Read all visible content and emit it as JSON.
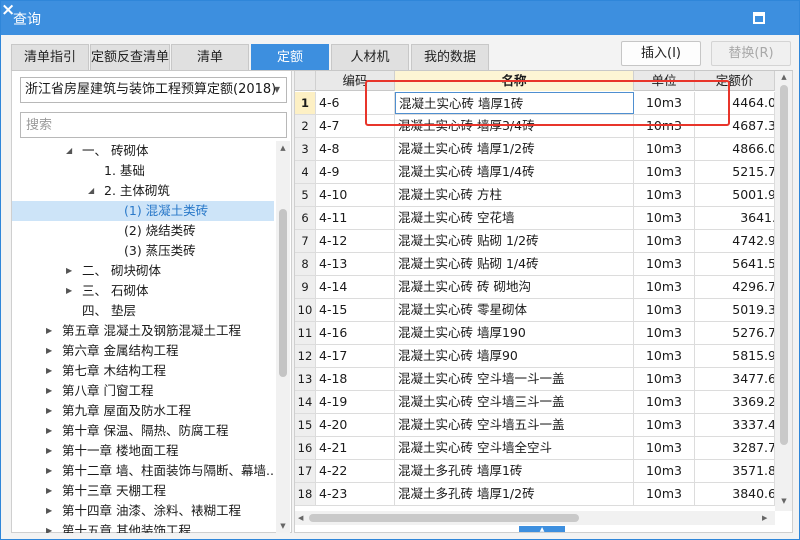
{
  "window": {
    "title": "查询"
  },
  "tabs": [
    {
      "label": "清单指引",
      "active": false
    },
    {
      "label": "定额反查清单",
      "active": false
    },
    {
      "label": "清单",
      "active": false
    },
    {
      "label": "定额",
      "active": true
    },
    {
      "label": "人材机",
      "active": false
    },
    {
      "label": "我的数据",
      "active": false
    }
  ],
  "buttons": {
    "insert": "插入(I)",
    "replace": "替换(R)"
  },
  "left": {
    "combo_value": "浙江省房屋建筑与装饰工程预算定额(2018)",
    "search_placeholder": "搜索",
    "tree": [
      {
        "label": "一、 砖砌体",
        "twisty": "expanded",
        "selected": false
      },
      {
        "label": "1. 基础",
        "twisty": "none",
        "selected": false
      },
      {
        "label": "2. 主体砌筑",
        "twisty": "expanded",
        "selected": false
      },
      {
        "label": "(1) 混凝土类砖",
        "twisty": "none",
        "selected": true
      },
      {
        "label": "(2) 烧结类砖",
        "twisty": "none",
        "selected": false
      },
      {
        "label": "(3) 蒸压类砖",
        "twisty": "none",
        "selected": false
      },
      {
        "label": "二、 砌块砌体",
        "twisty": "collapsed",
        "selected": false
      },
      {
        "label": "三、 石砌体",
        "twisty": "collapsed",
        "selected": false
      },
      {
        "label": "四、 垫层",
        "twisty": "none",
        "selected": false
      },
      {
        "label": "第五章 混凝土及钢筋混凝土工程",
        "twisty": "collapsed",
        "selected": false
      },
      {
        "label": "第六章 金属结构工程",
        "twisty": "collapsed",
        "selected": false
      },
      {
        "label": "第七章 木结构工程",
        "twisty": "collapsed",
        "selected": false
      },
      {
        "label": "第八章 门窗工程",
        "twisty": "collapsed",
        "selected": false
      },
      {
        "label": "第九章 屋面及防水工程",
        "twisty": "collapsed",
        "selected": false
      },
      {
        "label": "第十章 保温、隔热、防腐工程",
        "twisty": "collapsed",
        "selected": false
      },
      {
        "label": "第十一章 楼地面工程",
        "twisty": "collapsed",
        "selected": false
      },
      {
        "label": "第十二章 墙、柱面装饰与隔断、幕墙...",
        "twisty": "collapsed",
        "selected": false
      },
      {
        "label": "第十三章 天棚工程",
        "twisty": "collapsed",
        "selected": false
      },
      {
        "label": "第十四章 油漆、涂料、裱糊工程",
        "twisty": "collapsed",
        "selected": false
      },
      {
        "label": "第十五章 其他装饰工程",
        "twisty": "collapsed",
        "selected": false
      }
    ]
  },
  "grid": {
    "columns": {
      "code": "编码",
      "name": "名称",
      "unit": "单位",
      "price": "定额价"
    },
    "rows": [
      {
        "idx": "1",
        "code": "4-6",
        "name": "混凝土实心砖 墙厚1砖",
        "unit": "10m3",
        "price": "4464.0"
      },
      {
        "idx": "2",
        "code": "4-7",
        "name": "混凝土实心砖 墙厚3/4砖",
        "unit": "10m3",
        "price": "4687.3"
      },
      {
        "idx": "3",
        "code": "4-8",
        "name": "混凝土实心砖 墙厚1/2砖",
        "unit": "10m3",
        "price": "4866.0"
      },
      {
        "idx": "4",
        "code": "4-9",
        "name": "混凝土实心砖 墙厚1/4砖",
        "unit": "10m3",
        "price": "5215.7"
      },
      {
        "idx": "5",
        "code": "4-10",
        "name": "混凝土实心砖 方柱",
        "unit": "10m3",
        "price": "5001.9"
      },
      {
        "idx": "6",
        "code": "4-11",
        "name": "混凝土实心砖 空花墙",
        "unit": "10m3",
        "price": "3641."
      },
      {
        "idx": "7",
        "code": "4-12",
        "name": "混凝土实心砖 贴砌 1/2砖",
        "unit": "10m3",
        "price": "4742.9"
      },
      {
        "idx": "8",
        "code": "4-13",
        "name": "混凝土实心砖 贴砌 1/4砖",
        "unit": "10m3",
        "price": "5641.5"
      },
      {
        "idx": "9",
        "code": "4-14",
        "name": "混凝土实心砖 砖 砌地沟",
        "unit": "10m3",
        "price": "4296.7"
      },
      {
        "idx": "10",
        "code": "4-15",
        "name": "混凝土实心砖 零星砌体",
        "unit": "10m3",
        "price": "5019.3"
      },
      {
        "idx": "11",
        "code": "4-16",
        "name": "混凝土实心砖 墙厚190",
        "unit": "10m3",
        "price": "5276.7"
      },
      {
        "idx": "12",
        "code": "4-17",
        "name": "混凝土实心砖 墙厚90",
        "unit": "10m3",
        "price": "5815.9"
      },
      {
        "idx": "13",
        "code": "4-18",
        "name": "混凝土实心砖 空斗墙一斗一盖",
        "unit": "10m3",
        "price": "3477.6"
      },
      {
        "idx": "14",
        "code": "4-19",
        "name": "混凝土实心砖 空斗墙三斗一盖",
        "unit": "10m3",
        "price": "3369.2"
      },
      {
        "idx": "15",
        "code": "4-20",
        "name": "混凝土实心砖 空斗墙五斗一盖",
        "unit": "10m3",
        "price": "3337.4"
      },
      {
        "idx": "16",
        "code": "4-21",
        "name": "混凝土实心砖 空斗墙全空斗",
        "unit": "10m3",
        "price": "3287.7"
      },
      {
        "idx": "17",
        "code": "4-22",
        "name": "混凝土多孔砖 墙厚1砖",
        "unit": "10m3",
        "price": "3571.8"
      },
      {
        "idx": "18",
        "code": "4-23",
        "name": "混凝土多孔砖 墙厚1/2砖",
        "unit": "10m3",
        "price": "3840.6"
      }
    ]
  },
  "colors": {
    "accent": "#3d8fdf",
    "highlight_box": "#e8352b",
    "selected_tree_bg": "#cde4f8"
  }
}
